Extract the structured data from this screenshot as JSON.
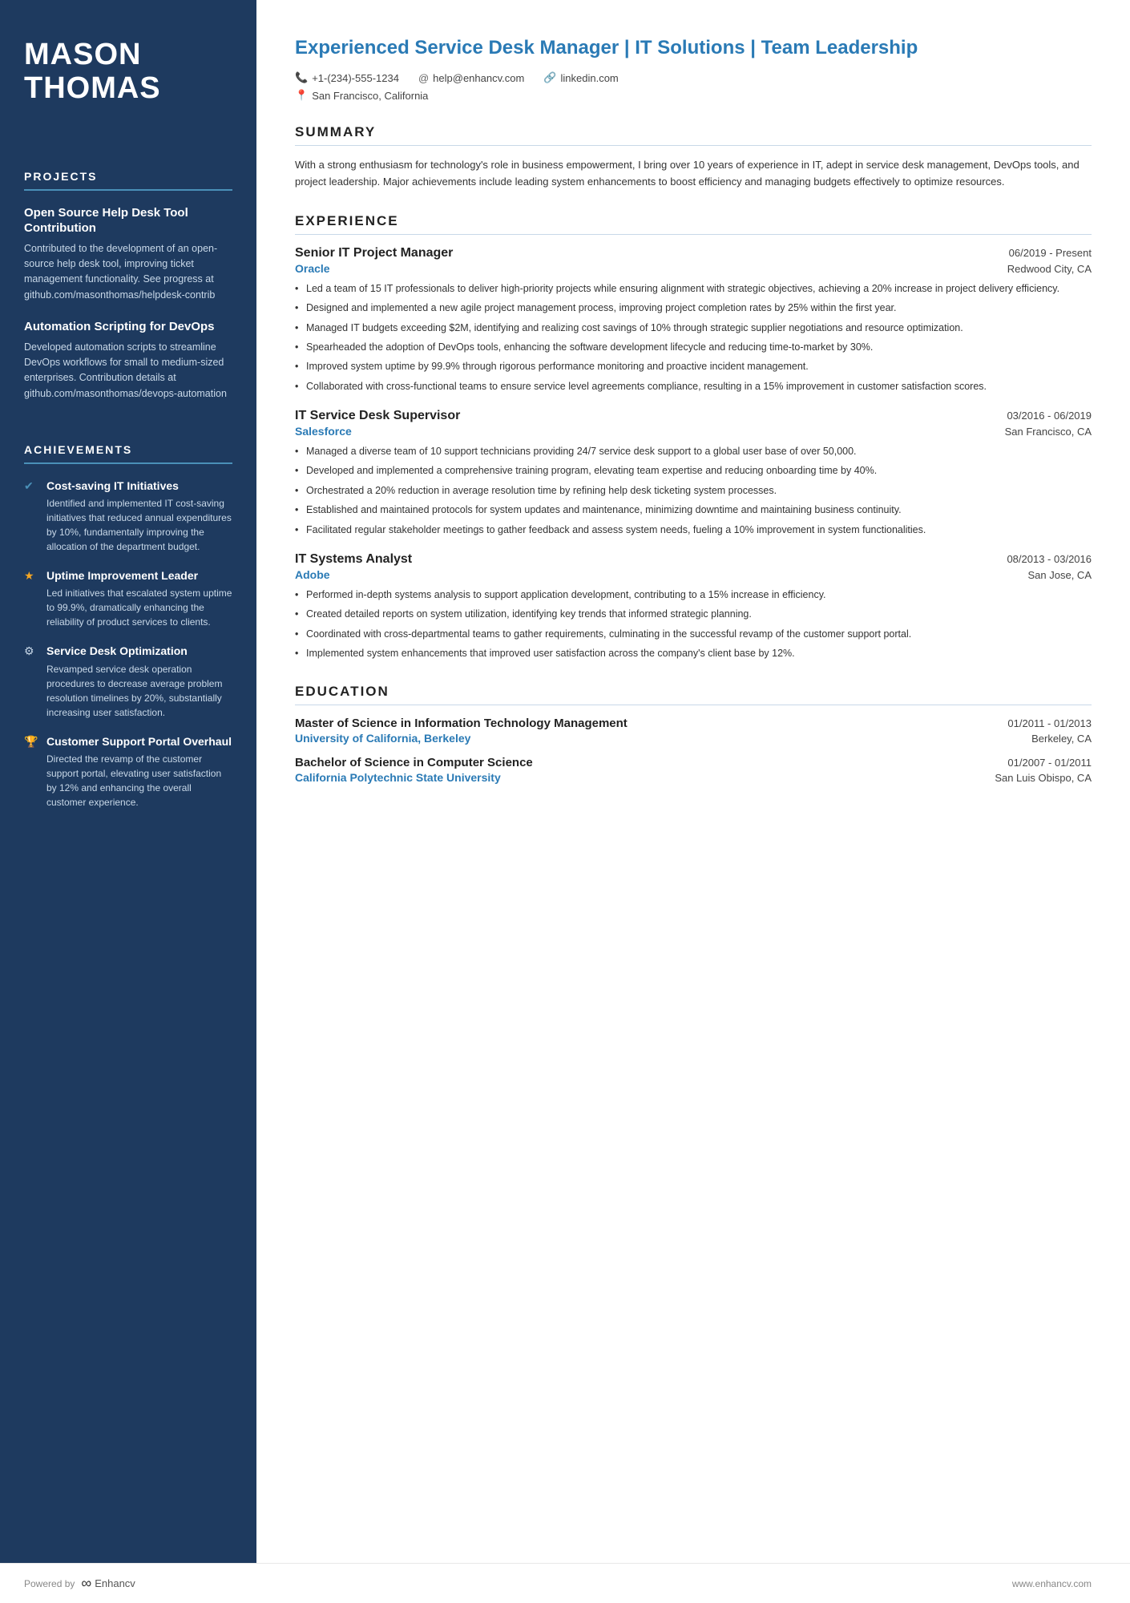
{
  "sidebar": {
    "name_line1": "MASON",
    "name_line2": "THOMAS",
    "projects_title": "PROJECTS",
    "project1": {
      "title": "Open Source Help Desk Tool Contribution",
      "desc": "Contributed to the development of an open-source help desk tool, improving ticket management functionality. See progress at github.com/masonthomas/helpdesk-contrib"
    },
    "project2": {
      "title": "Automation Scripting for DevOps",
      "desc": "Developed automation scripts to streamline DevOps workflows for small to medium-sized enterprises. Contribution details at github.com/masonthomas/devops-automation"
    },
    "achievements_title": "ACHIEVEMENTS",
    "achievements": [
      {
        "icon": "✔",
        "icon_type": "check",
        "title": "Cost-saving IT Initiatives",
        "desc": "Identified and implemented IT cost-saving initiatives that reduced annual expenditures by 10%, fundamentally improving the allocation of the department budget."
      },
      {
        "icon": "★",
        "icon_type": "star",
        "title": "Uptime Improvement Leader",
        "desc": "Led initiatives that escalated system uptime to 99.9%, dramatically enhancing the reliability of product services to clients."
      },
      {
        "icon": "⚙",
        "icon_type": "lock",
        "title": "Service Desk Optimization",
        "desc": "Revamped service desk operation procedures to decrease average problem resolution timelines by 20%, substantially increasing user satisfaction."
      },
      {
        "icon": "🏆",
        "icon_type": "trophy",
        "title": "Customer Support Portal Overhaul",
        "desc": "Directed the revamp of the customer support portal, elevating user satisfaction by 12% and enhancing the overall customer experience."
      }
    ]
  },
  "main": {
    "header_title": "Experienced Service Desk Manager | IT Solutions | Team Leadership",
    "contact": {
      "phone": "+1-(234)-555-1234",
      "email": "help@enhancv.com",
      "linkedin": "linkedin.com",
      "location": "San Francisco, California"
    },
    "summary_title": "SUMMARY",
    "summary_text": "With a strong enthusiasm for technology's role in business empowerment, I bring over 10 years of experience in IT, adept in service desk management, DevOps tools, and project leadership. Major achievements include leading system enhancements to boost efficiency and managing budgets effectively to optimize resources.",
    "experience_title": "EXPERIENCE",
    "experience": [
      {
        "title": "Senior IT Project Manager",
        "dates": "06/2019 - Present",
        "company": "Oracle",
        "location": "Redwood City, CA",
        "bullets": [
          "Led a team of 15 IT professionals to deliver high-priority projects while ensuring alignment with strategic objectives, achieving a 20% increase in project delivery efficiency.",
          "Designed and implemented a new agile project management process, improving project completion rates by 25% within the first year.",
          "Managed IT budgets exceeding $2M, identifying and realizing cost savings of 10% through strategic supplier negotiations and resource optimization.",
          "Spearheaded the adoption of DevOps tools, enhancing the software development lifecycle and reducing time-to-market by 30%.",
          "Improved system uptime by 99.9% through rigorous performance monitoring and proactive incident management.",
          "Collaborated with cross-functional teams to ensure service level agreements compliance, resulting in a 15% improvement in customer satisfaction scores."
        ]
      },
      {
        "title": "IT Service Desk Supervisor",
        "dates": "03/2016 - 06/2019",
        "company": "Salesforce",
        "location": "San Francisco, CA",
        "bullets": [
          "Managed a diverse team of 10 support technicians providing 24/7 service desk support to a global user base of over 50,000.",
          "Developed and implemented a comprehensive training program, elevating team expertise and reducing onboarding time by 40%.",
          "Orchestrated a 20% reduction in average resolution time by refining help desk ticketing system processes.",
          "Established and maintained protocols for system updates and maintenance, minimizing downtime and maintaining business continuity.",
          "Facilitated regular stakeholder meetings to gather feedback and assess system needs, fueling a 10% improvement in system functionalities."
        ]
      },
      {
        "title": "IT Systems Analyst",
        "dates": "08/2013 - 03/2016",
        "company": "Adobe",
        "location": "San Jose, CA",
        "bullets": [
          "Performed in-depth systems analysis to support application development, contributing to a 15% increase in efficiency.",
          "Created detailed reports on system utilization, identifying key trends that informed strategic planning.",
          "Coordinated with cross-departmental teams to gather requirements, culminating in the successful revamp of the customer support portal.",
          "Implemented system enhancements that improved user satisfaction across the company's client base by 12%."
        ]
      }
    ],
    "education_title": "EDUCATION",
    "education": [
      {
        "degree": "Master of Science in Information Technology Management",
        "dates": "01/2011 - 01/2013",
        "school": "University of California, Berkeley",
        "location": "Berkeley, CA"
      },
      {
        "degree": "Bachelor of Science in Computer Science",
        "dates": "01/2007 - 01/2011",
        "school": "California Polytechnic State University",
        "location": "San Luis Obispo, CA"
      }
    ]
  },
  "footer": {
    "powered_by": "Powered by",
    "brand": "Enhancv",
    "website": "www.enhancv.com"
  }
}
